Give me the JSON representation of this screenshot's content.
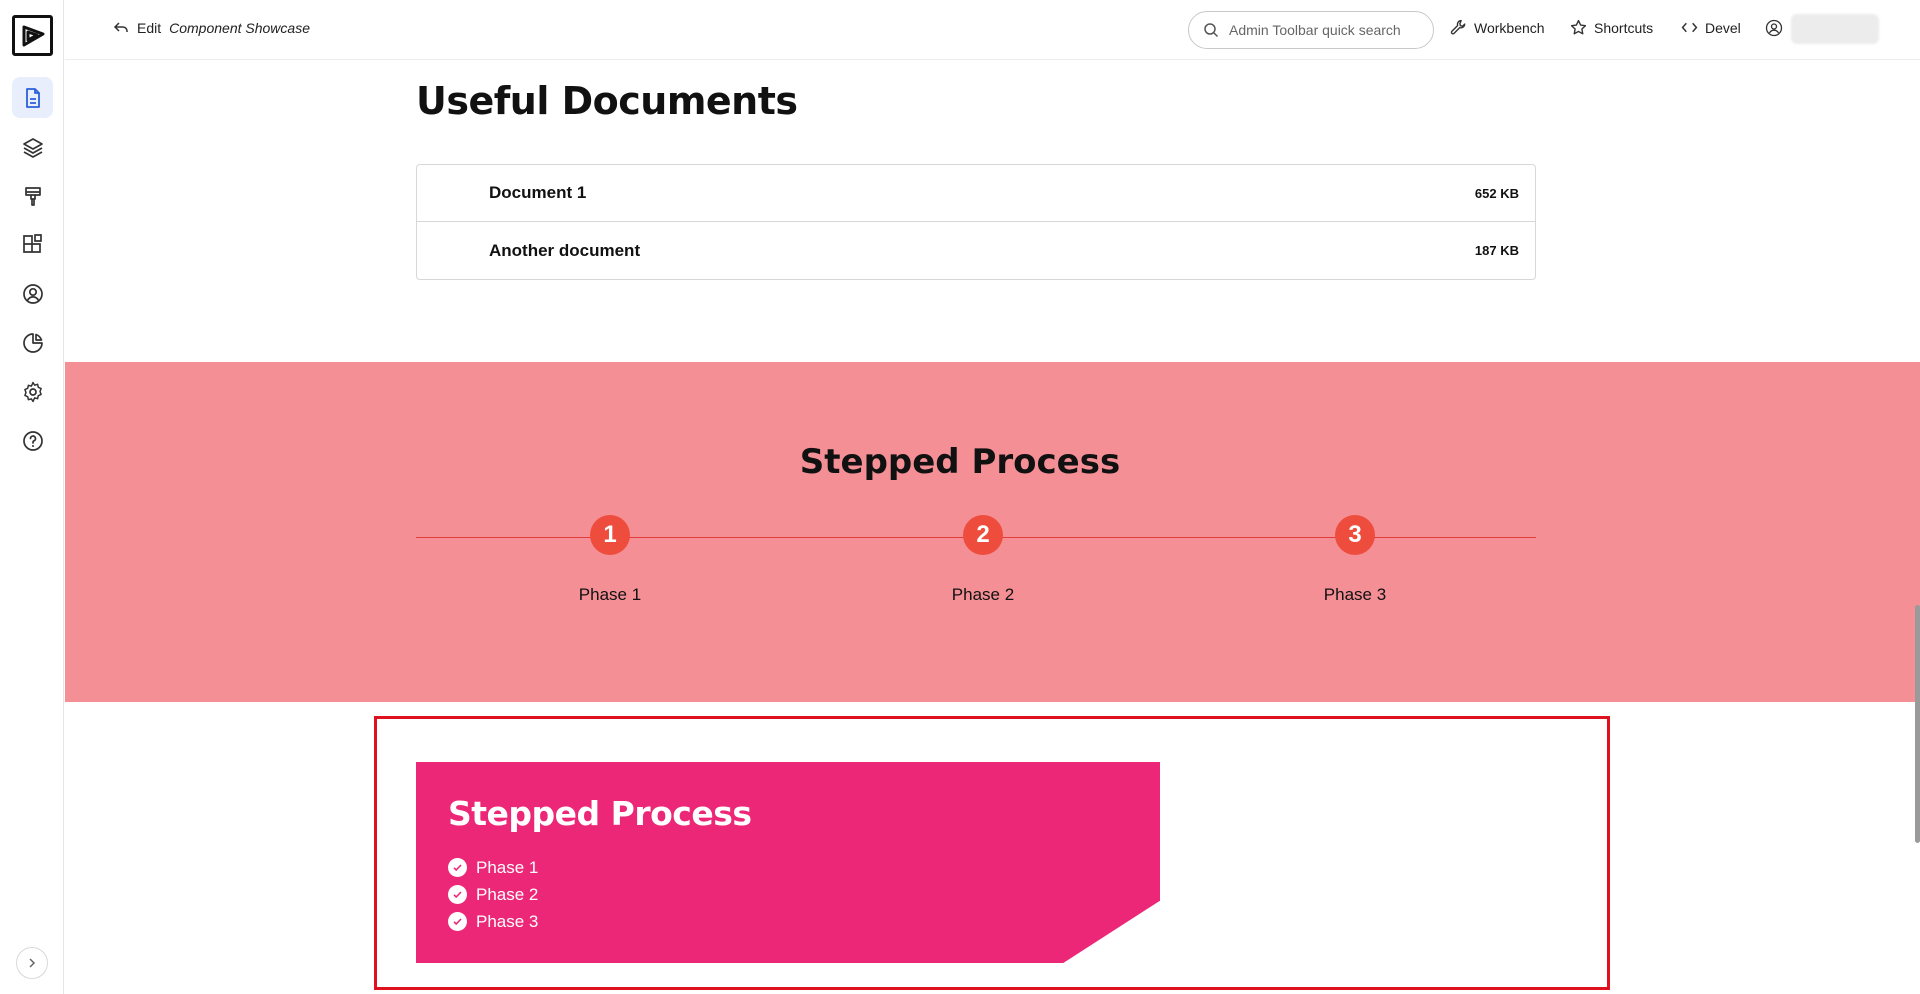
{
  "toolbar": {
    "edit_prefix": "Edit",
    "edit_title": "Component Showcase",
    "search_placeholder": "Admin Toolbar quick search",
    "workbench": "Workbench",
    "shortcuts": "Shortcuts",
    "devel": "Devel"
  },
  "sidebar": {
    "items": [
      {
        "icon": "document-icon",
        "active": true
      },
      {
        "icon": "layers-icon",
        "active": false
      },
      {
        "icon": "paint-brush-icon",
        "active": false
      },
      {
        "icon": "blocks-icon",
        "active": false
      },
      {
        "icon": "user-circle-icon",
        "active": false
      },
      {
        "icon": "pie-chart-icon",
        "active": false
      },
      {
        "icon": "gear-icon",
        "active": false
      },
      {
        "icon": "help-icon",
        "active": false
      }
    ]
  },
  "documents": {
    "heading": "Useful Documents",
    "items": [
      {
        "name": "Document 1",
        "size": "652 KB"
      },
      {
        "name": "Another document",
        "size": "187 KB"
      }
    ]
  },
  "stepped_band": {
    "heading": "Stepped Process",
    "steps": [
      {
        "number": "1",
        "label": "Phase 1"
      },
      {
        "number": "2",
        "label": "Phase 2"
      },
      {
        "number": "3",
        "label": "Phase 3"
      }
    ]
  },
  "stepped_card": {
    "heading": "Stepped Process",
    "items": [
      "Phase 1",
      "Phase 2",
      "Phase 3"
    ]
  },
  "colors": {
    "band": "#f48f95",
    "step_circle": "#ee4d3e",
    "card": "#ec2777",
    "highlight": "#e0111f",
    "active_nav": "#e8eefc"
  }
}
